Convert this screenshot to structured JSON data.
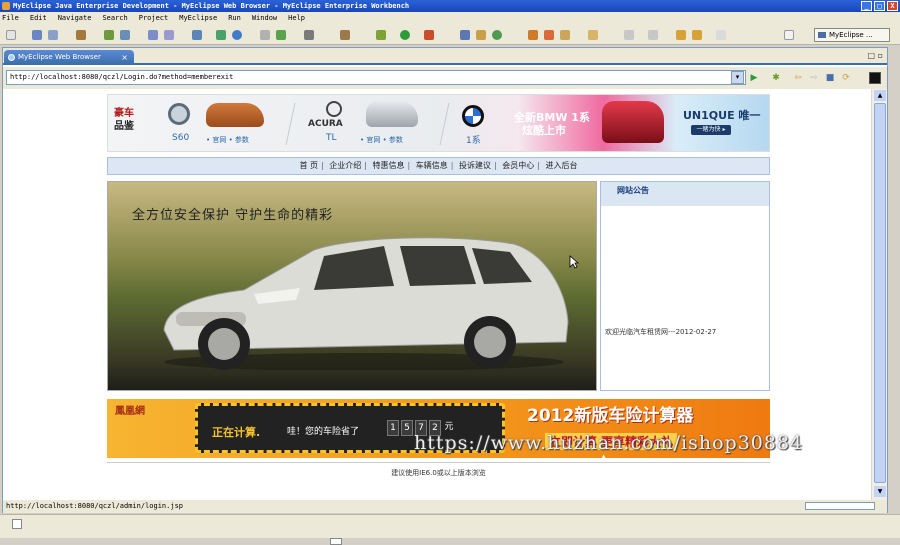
{
  "window": {
    "title": "MyEclipse Java Enterprise Development - MyEclipse Web Browser - MyEclipse Enterprise Workbench",
    "buttons": [
      "_",
      "□",
      "X"
    ]
  },
  "menu": [
    "File",
    "Edit",
    "Navigate",
    "Search",
    "Project",
    "MyEclipse",
    "Run",
    "Window",
    "Help"
  ],
  "perspective": "MyEclipse ...",
  "editor": {
    "tab_label": "MyEclipse Web Browser",
    "tab_close": "×",
    "tab_controls": "□ ▫",
    "url": "http://localhost:8080/qczl/Login.do?method=memberexit",
    "status_url": "http://localhost:8080/qczl/admin/login.jsp"
  },
  "site": {
    "banner": {
      "brand_line1": "豪车",
      "brand_line2": "品鉴",
      "volvo_model": "S60",
      "volvo_links": "• 官网 • 参数",
      "acura_logo": "ACURA",
      "acura_model": "TL",
      "acura_links": "• 官网 • 参数",
      "bmw_model": "1系",
      "bmw_text_line1": "全新BMW 1系",
      "bmw_text_line2": "炫酷上市",
      "unique_text": "UN1QUE 唯一",
      "unique_button": "一睹为快 ▸"
    },
    "nav": [
      "首 页",
      "企业介绍",
      "特惠信息",
      "车辆信息",
      "投诉建议",
      "会员中心",
      "进入后台"
    ],
    "nav_separator": "|",
    "hero_slogan": "全方位安全保护  守护生命的精彩",
    "notice": {
      "title": "网站公告",
      "items": [
        "欢迎光临汽车租赁网---2012-02-27"
      ]
    },
    "ad": {
      "logo": "鳳凰網",
      "calc_text": "正在计算.",
      "save_text": "哇！您的车险省了",
      "digits": [
        "1",
        "5",
        "7",
        "2",
        "元"
      ],
      "title": "2012新版车险计算器",
      "subtitle": "立即计算 更享精彩大礼",
      "arrow": "▲"
    },
    "footer": "建议使用IE6.0或以上版本浏览"
  },
  "watermark": "https://www.huzhan.com/ishop30884",
  "colors": {
    "titlebar": "#1946b8",
    "tab_active": "#3a6ea5",
    "nav_bg": "#dde7f4",
    "ad_orange": "#f39a1d",
    "brand_red": "#b31a1a"
  }
}
